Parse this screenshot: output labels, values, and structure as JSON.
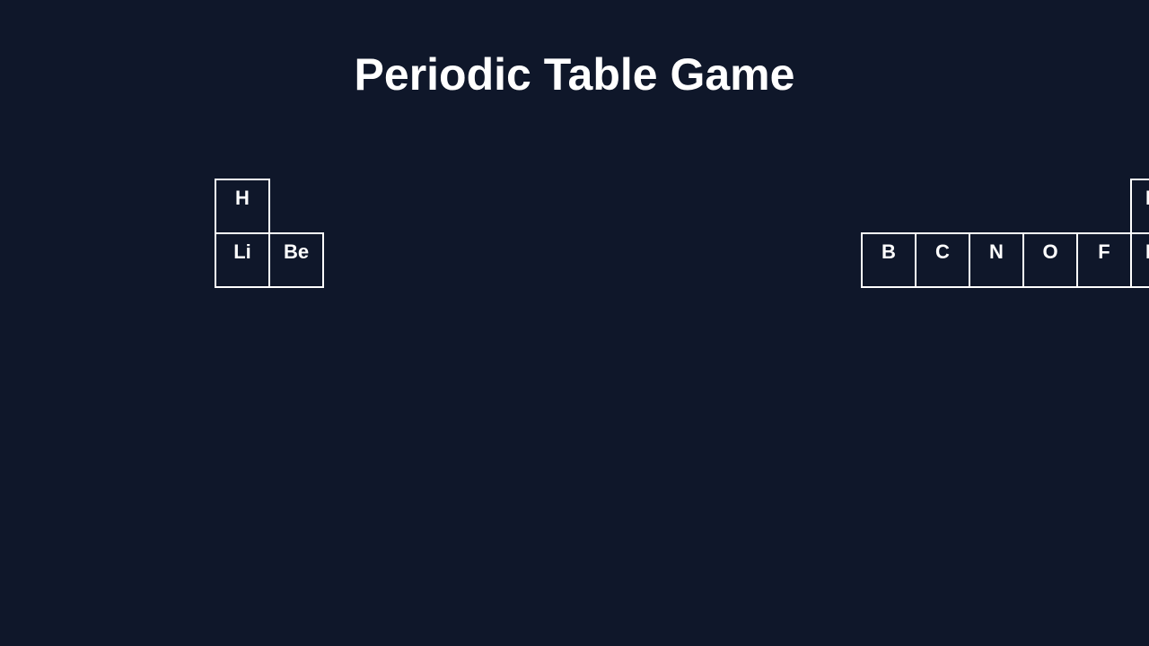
{
  "page": {
    "title": "Periodic Table Game",
    "background_color": "#0f172a",
    "text_color": "#ffffff",
    "border_color": "#ffffff"
  },
  "elements": {
    "h": "H",
    "he": "He",
    "li": "Li",
    "be": "Be",
    "b": "B",
    "c": "C",
    "n": "N",
    "o": "O",
    "f": "F",
    "ne": "Ne"
  }
}
